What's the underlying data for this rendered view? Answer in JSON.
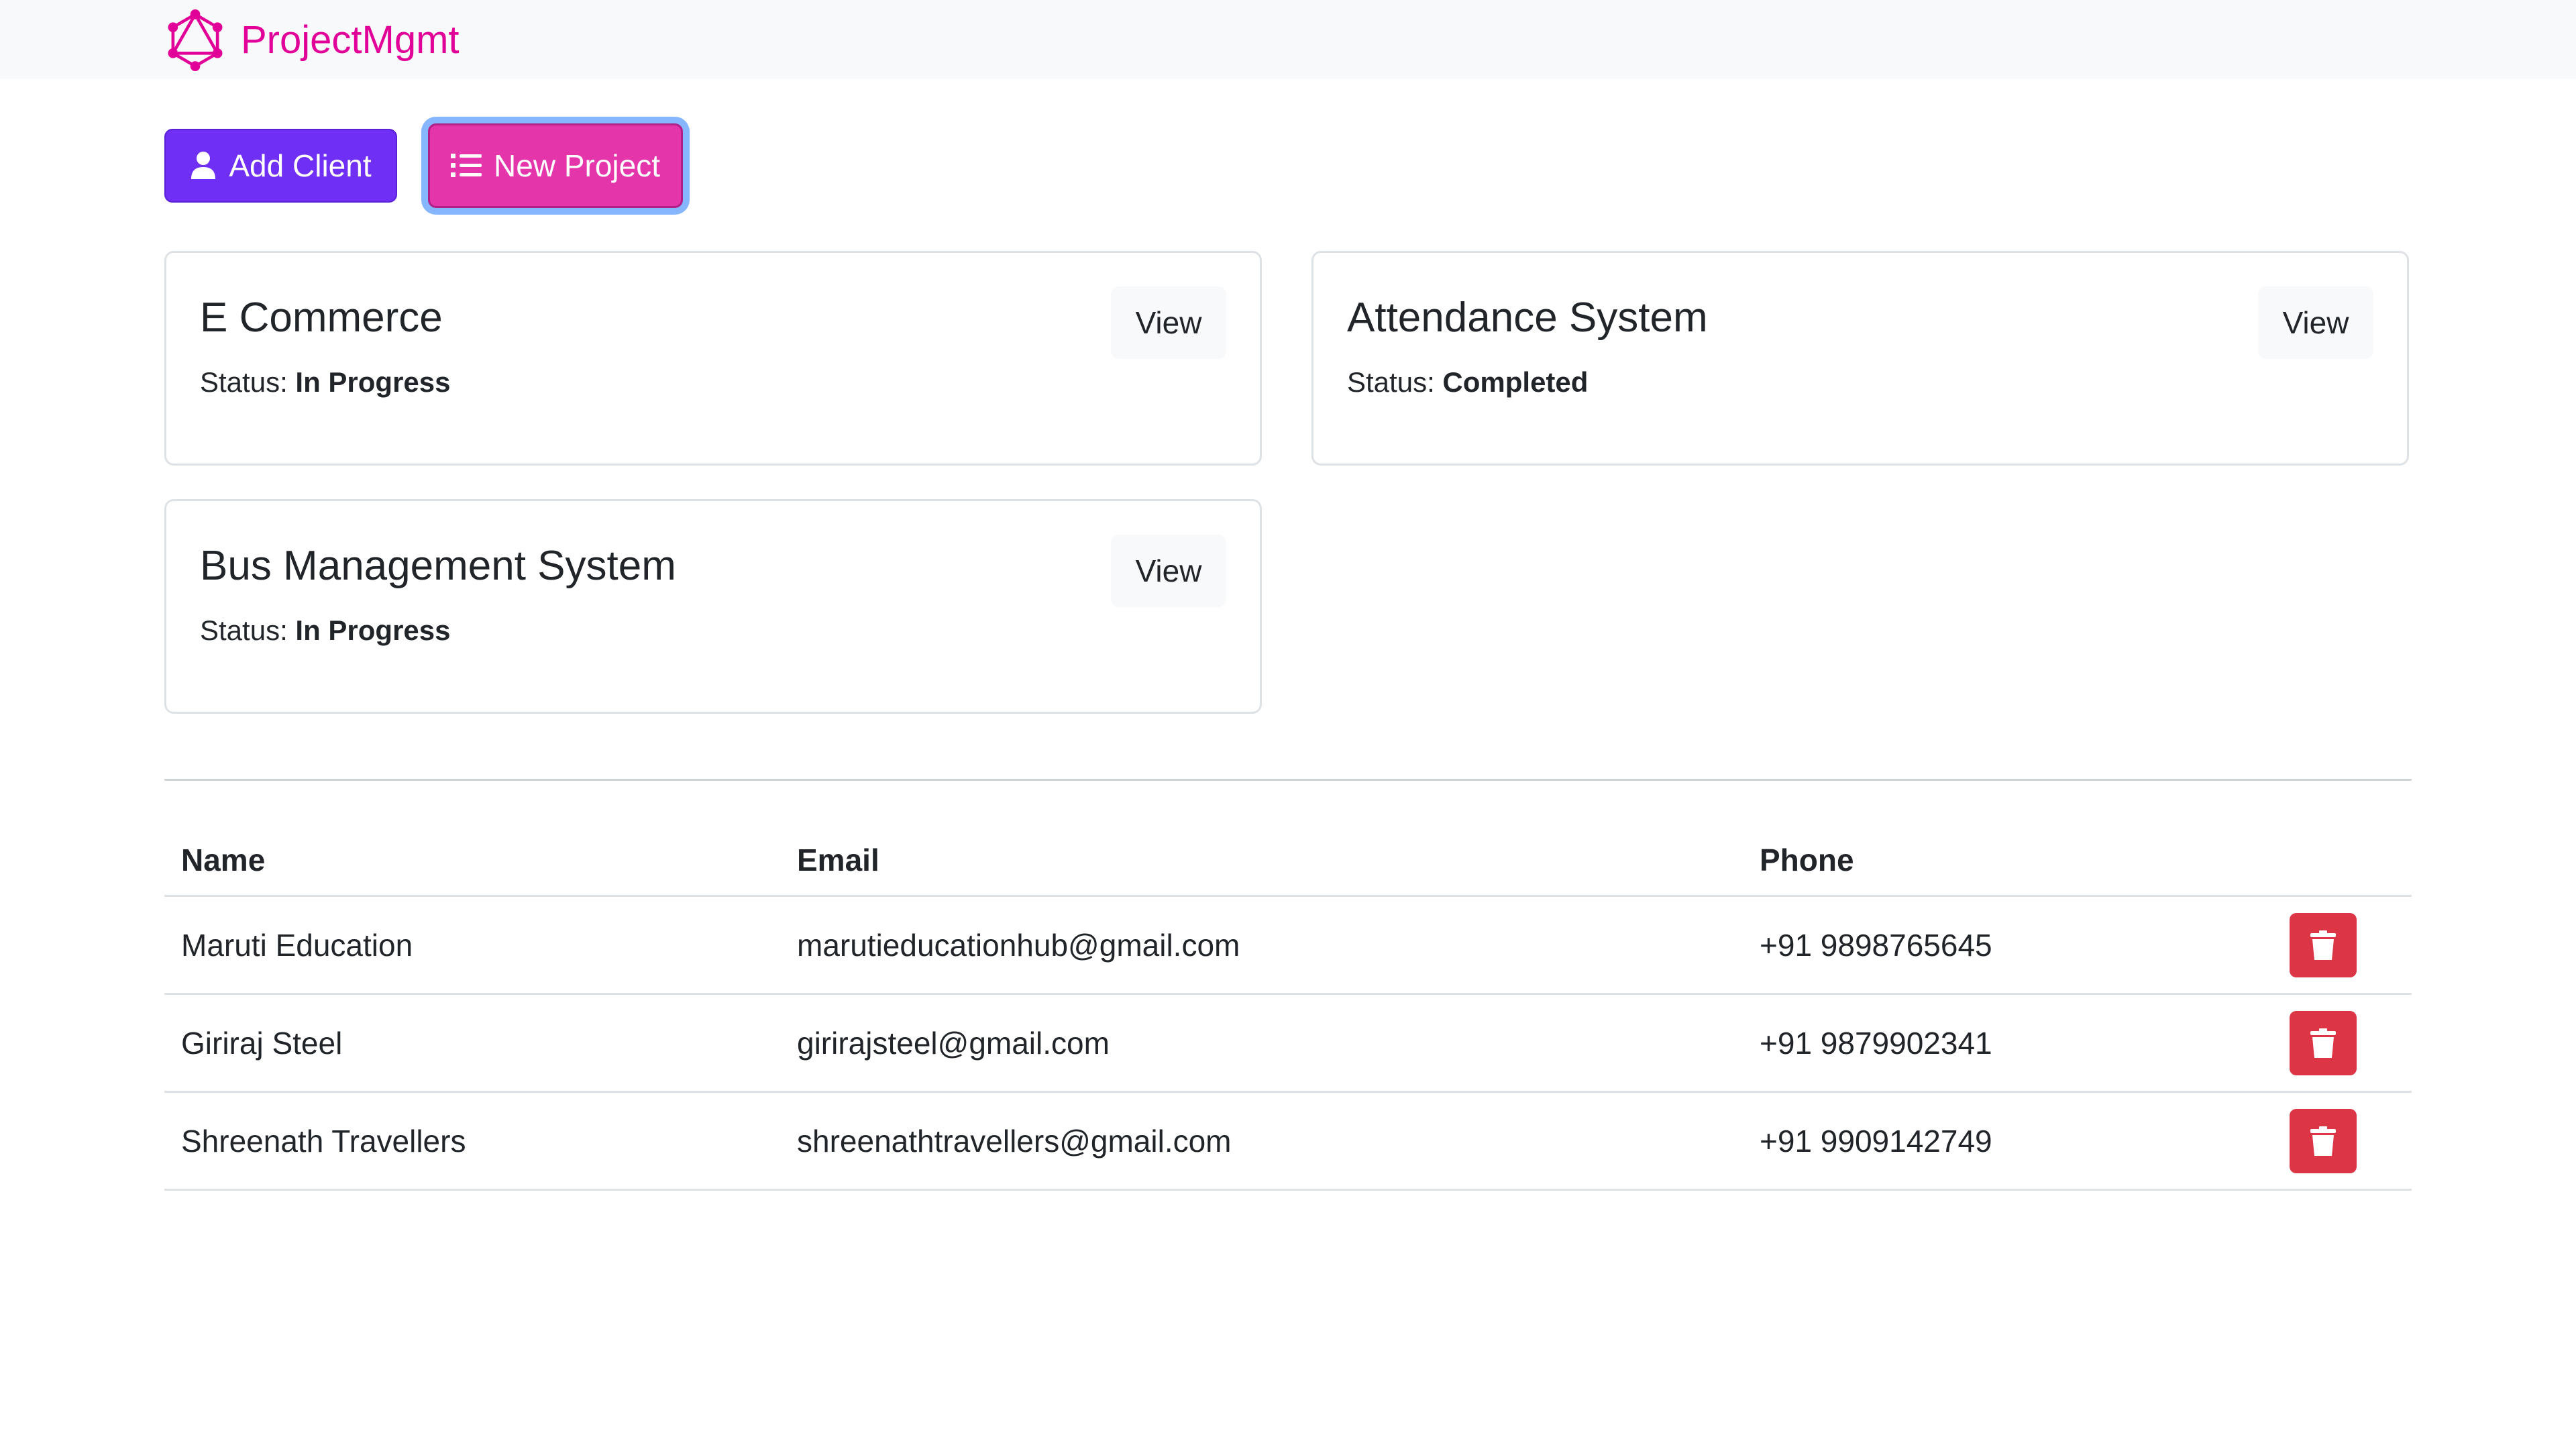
{
  "navbar": {
    "logo_icon": "graphql-logo-icon",
    "brand": "ProjectMgmt",
    "brand_color": "#e10098"
  },
  "actions": {
    "add_client": {
      "label": "Add Client",
      "icon": "user-icon",
      "color": "#6f2ff5"
    },
    "new_project": {
      "label": "New Project",
      "icon": "list-icon",
      "color": "#e535ab"
    }
  },
  "projects": [
    {
      "name": "E Commerce",
      "status_label": "Status:",
      "status": "In Progress",
      "view_label": "View"
    },
    {
      "name": "Attendance System",
      "status_label": "Status:",
      "status": "Completed",
      "view_label": "View"
    },
    {
      "name": "Bus Management System",
      "status_label": "Status:",
      "status": "In Progress",
      "view_label": "View"
    }
  ],
  "clients_table": {
    "headers": {
      "name": "Name",
      "email": "Email",
      "phone": "Phone"
    },
    "rows": [
      {
        "name": "Maruti Education",
        "email": "marutieducationhub@gmail.com",
        "phone": "+91 9898765645",
        "delete_icon": "trash-icon"
      },
      {
        "name": "Giriraj Steel",
        "email": "girirajsteel@gmail.com",
        "phone": "+91 9879902341",
        "delete_icon": "trash-icon"
      },
      {
        "name": "Shreenath Travellers",
        "email": "shreenathtravellers@gmail.com",
        "phone": "+91 9909142749",
        "delete_icon": "trash-icon"
      }
    ],
    "delete_color": "#dc3545"
  }
}
